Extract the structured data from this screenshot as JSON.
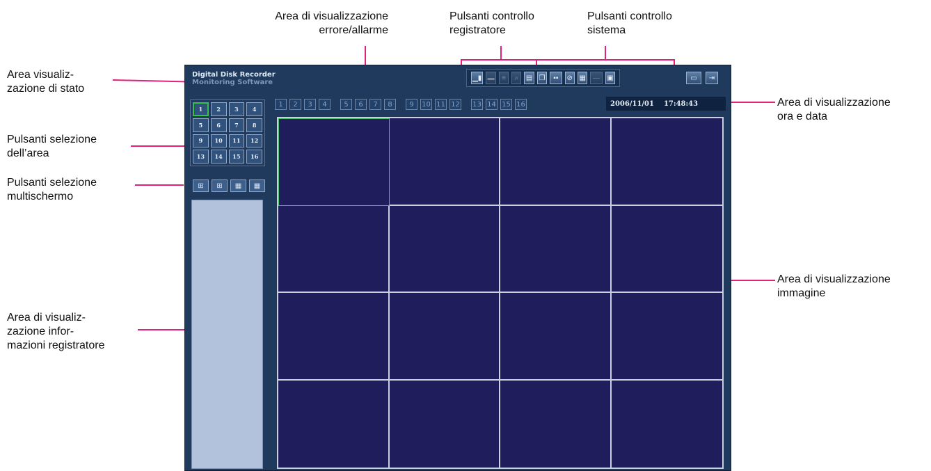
{
  "callouts": {
    "alarm_area": "Area di visualizzazione\nerrore/allarme",
    "recorder_controls": "Pulsanti controllo\nregistratore",
    "system_controls": "Pulsanti controllo\nsistema",
    "status_area": "Area visualiz-\nzazione di stato",
    "area_select": "Pulsanti selezione\ndell’area",
    "multiscreen_select": "Pulsanti selezione\nmultischermo",
    "recorder_info": "Area di visualiz-\nzazione infor-\nmazioni registratore",
    "datetime_area": "Area di visualizzazione\nora e data",
    "image_area": "Area di visualizzazione\nimmagine"
  },
  "app": {
    "title_line1": "Digital Disk Recorder",
    "title_line2": "Monitoring Software",
    "date": "2006/11/01",
    "time": "17:48:43",
    "area_buttons": [
      "1",
      "2",
      "3",
      "4",
      "5",
      "6",
      "7",
      "8",
      "9",
      "10",
      "11",
      "12",
      "13",
      "14",
      "15",
      "16"
    ],
    "selected_area": "1",
    "camera_channels": [
      "1",
      "2",
      "3",
      "4",
      "5",
      "6",
      "7",
      "8",
      "9",
      "10",
      "11",
      "12",
      "13",
      "14",
      "15",
      "16"
    ],
    "recorder_icons": [
      "rec-icon",
      "stop-icon",
      "play-icon",
      "search-icon",
      "disk-icon",
      "copy-icon",
      "dual-screen-icon",
      "link-icon",
      "grid-icon"
    ],
    "system_icons": [
      "monitor-icon",
      "exit-icon"
    ],
    "multiscreen_icons": [
      "single-screen-icon",
      "quad-screen-icon",
      "nine-screen-icon",
      "sixteen-screen-icon"
    ]
  },
  "colors": {
    "window": "#1f3a5c",
    "image_bg": "#201d5c",
    "leader": "#e0217e",
    "selection": "#38c14a"
  }
}
